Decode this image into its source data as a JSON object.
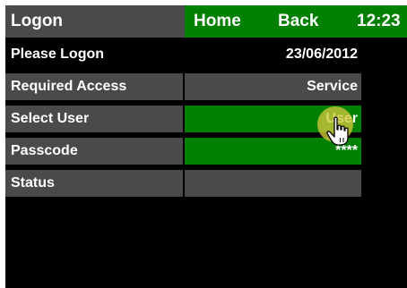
{
  "header": {
    "title": "Logon",
    "home_label": "Home",
    "back_label": "Back",
    "time": "12:23"
  },
  "info": {
    "prompt": "Please Logon",
    "date": "23/06/2012"
  },
  "rows": [
    {
      "label": "Required Access",
      "value": "Service"
    },
    {
      "label": "Select User",
      "value": "User"
    },
    {
      "label": "Passcode",
      "value": "****"
    },
    {
      "label": "Status",
      "value": ""
    }
  ],
  "colors": {
    "background": "#000000",
    "panel_gray": "#4a4a4a",
    "accent_green": "#008000",
    "text": "#ffffff",
    "cursor_highlight": "#d2c83c"
  },
  "icons": {
    "cursor": "hand-pointer-icon"
  }
}
